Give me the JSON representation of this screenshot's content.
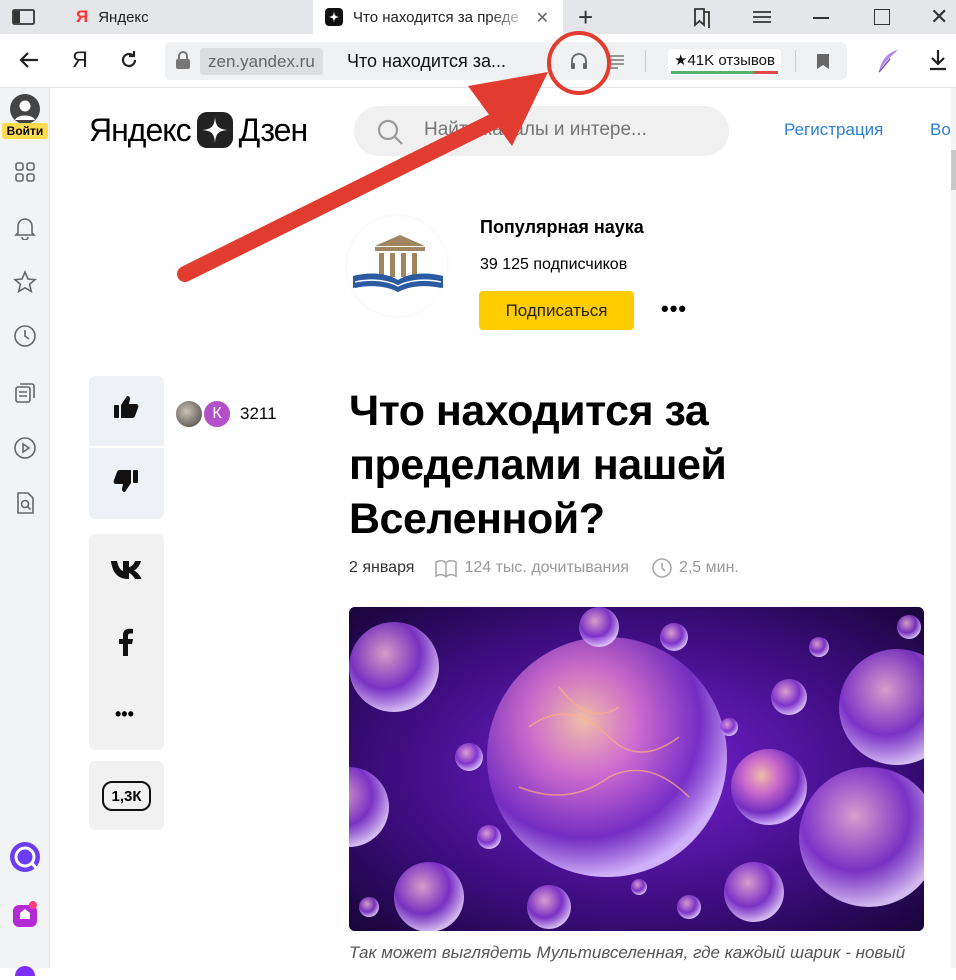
{
  "browser": {
    "tabs": [
      {
        "label": "Яндекс",
        "favicon": "yandex-logo"
      },
      {
        "label": "Что находится за преде",
        "favicon": "zen-logo",
        "active": true
      }
    ],
    "address": {
      "domain": "zen.yandex.ru",
      "page_title": "Что находится за...",
      "reviews": "41K отзывов",
      "reviews_star": "★"
    },
    "nav": {
      "yandex_letter": "Я"
    }
  },
  "sidebar": {
    "login_label": "Войти",
    "icons": [
      "profile-icon",
      "apps-grid-icon",
      "bell-icon",
      "star-icon",
      "history-icon",
      "collections-icon",
      "video-icon",
      "lens-icon",
      "alice-icon",
      "messenger-icon"
    ]
  },
  "site": {
    "logo_left": "Яндекс",
    "logo_right": "Дзен",
    "search_placeholder": "Найти каналы и интере...",
    "register": "Регистрация",
    "login": "Во"
  },
  "channel": {
    "name": "Популярная наука",
    "subscribers": "39 125 подписчиков",
    "subscribe": "Подписаться",
    "more": "•••"
  },
  "article": {
    "title": "Что находится за пределами нашей Вселенной?",
    "date": "2 января",
    "reads": "124 тыс. дочитывания",
    "read_time": "2,5 мин.",
    "caption": "Так может выглядеть Мультивселенная, где каждый шарик - новый"
  },
  "reactions": {
    "likes": "3211",
    "liker_initial": "К",
    "comments": "1,3К",
    "share_more": "•••",
    "vk_label": "vk"
  },
  "colors": {
    "accent_yellow": "#ffcc00",
    "link_blue": "#2a7fd4",
    "annotation_red": "#e23b2f"
  }
}
